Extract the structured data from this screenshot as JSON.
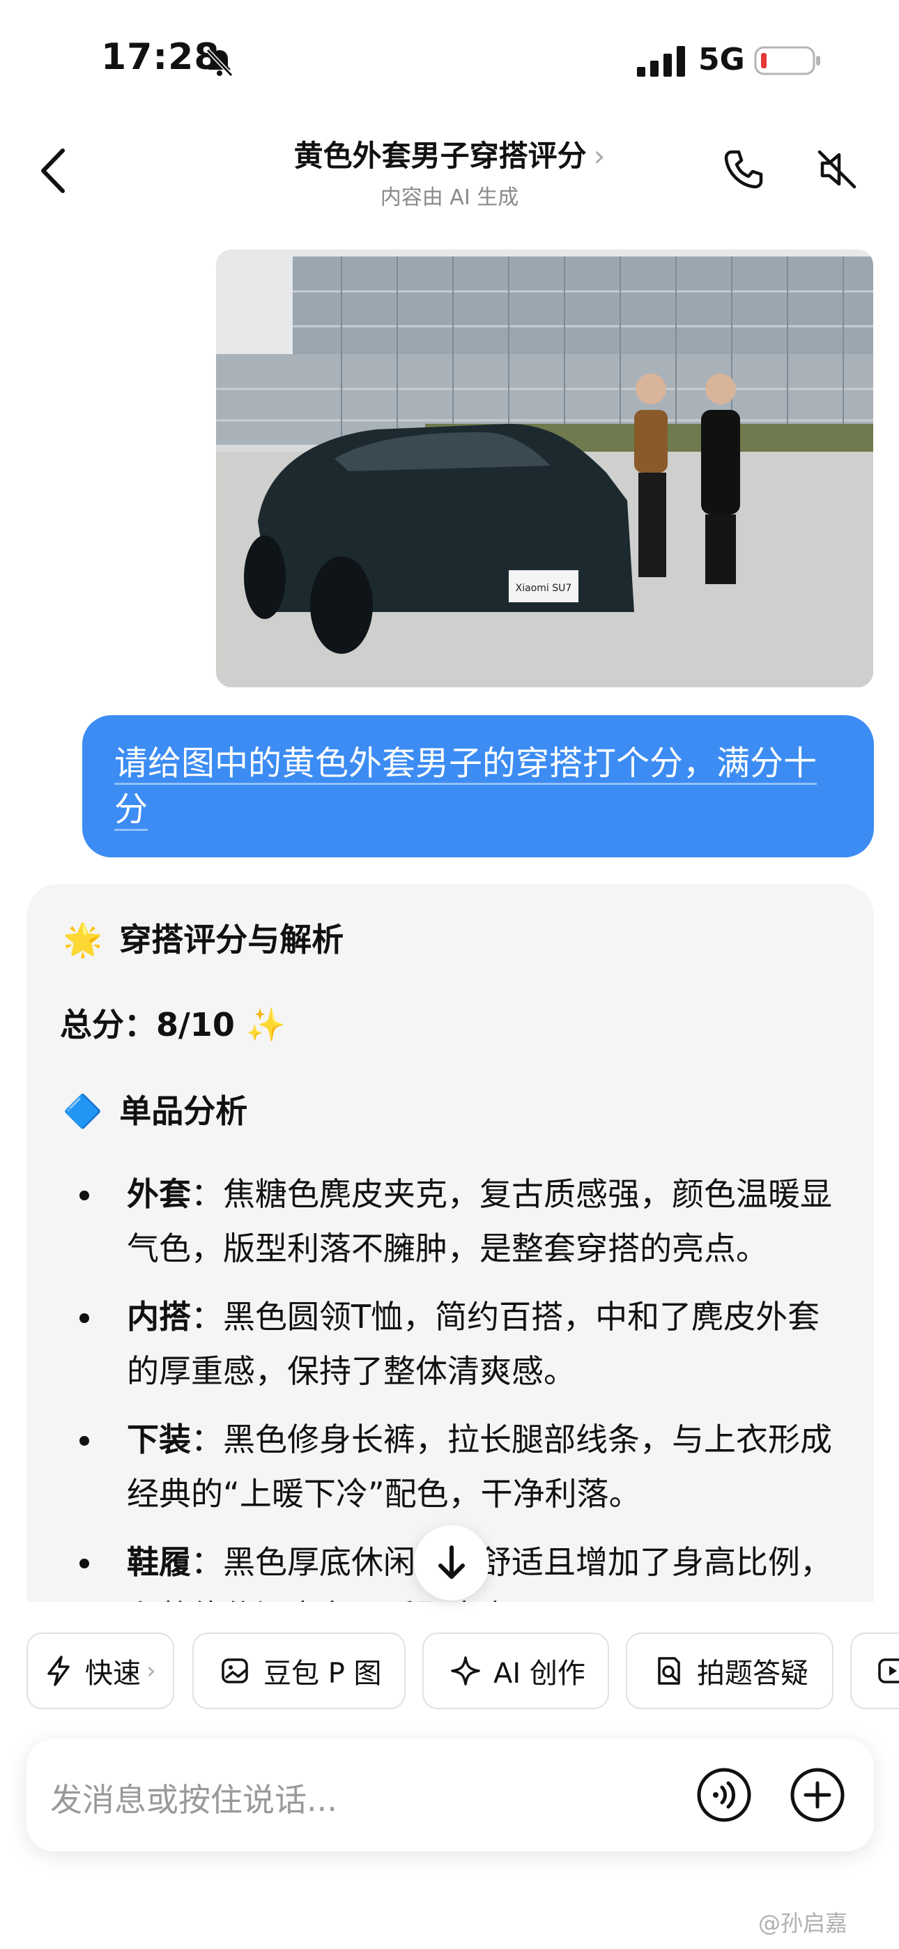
{
  "status_bar": {
    "time": "17:28",
    "network": "5G"
  },
  "header": {
    "title": "黄色外套男子穿搭评分",
    "title_chevron": "›",
    "subtitle": "内容由 AI 生成"
  },
  "photo": {
    "plate_text": "Xiaomi SU7"
  },
  "user_message": {
    "text": "请给图中的黄色外套男子的穿搭打个分，满分十分"
  },
  "ai_reply": {
    "heading_emoji": "🌟",
    "heading": "穿搭评分与解析",
    "score_label": "总分：8/10",
    "score_emoji": "✨",
    "section_emoji": "🔷",
    "section_title": "单品分析",
    "items": [
      {
        "term": "外套",
        "sep": "：",
        "text": "焦糖色麂皮夹克，复古质感强，颜色温暖显气色，版型利落不臃肿，是整套穿搭的亮点。"
      },
      {
        "term": "内搭",
        "sep": "：",
        "text": "黑色圆领T恤，简约百搭，中和了麂皮外套的厚重感，保持了整体清爽感。"
      },
      {
        "term": "下装",
        "sep": "：",
        "text": "黑色修身长裤，拉长腿部线条，与上衣形成经典的“上暖下冷”配色，干净利落。"
      },
      {
        "term": "鞋履",
        "sep": "：",
        "text": "黑色厚底休闲鞋，舒适且增加了身高比例，和整体休闲商务风适配度高。"
      }
    ]
  },
  "quick_actions": [
    {
      "label": "快速",
      "icon": "lightning-icon",
      "chevron": "›"
    },
    {
      "label": "豆包 P 图",
      "icon": "image-edit-icon"
    },
    {
      "label": "AI 创作",
      "icon": "sparkle-icon"
    },
    {
      "label": "拍题答疑",
      "icon": "search-document-icon"
    }
  ],
  "input": {
    "placeholder": "发消息或按住说话..."
  },
  "watermark": "@孙启嘉"
}
